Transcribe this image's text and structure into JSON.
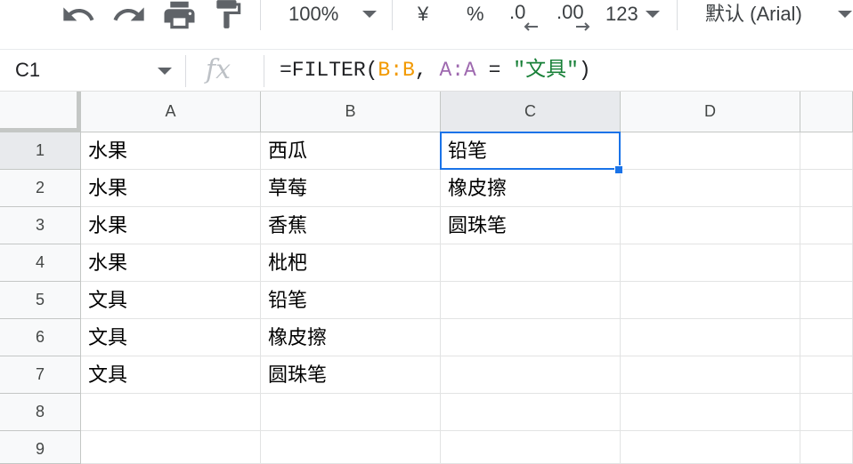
{
  "toolbar": {
    "icons": {
      "undo": "undo-icon",
      "redo": "redo-icon",
      "print": "print-icon",
      "paint_format": "paint-format-icon",
      "dropdown": "chevron-down-icon"
    },
    "zoom": "100%",
    "currency": "¥",
    "percent": "%",
    "decrease_decimal": ".0",
    "increase_decimal": ".00",
    "more_formats": "123",
    "font_selector": "默认 (Arial)"
  },
  "formula_bar": {
    "name_box": "C1",
    "fx": "fx",
    "tokens": [
      {
        "text": "=FILTER(",
        "color": "#202124"
      },
      {
        "text": "B:B",
        "color": "#f29900"
      },
      {
        "text": ", ",
        "color": "#202124"
      },
      {
        "text": "A:A",
        "color": "#9e69af"
      },
      {
        "text": " = ",
        "color": "#202124"
      },
      {
        "text": "\"文具\"",
        "color": "#188038"
      },
      {
        "text": ")",
        "color": "#202124"
      }
    ]
  },
  "sheet": {
    "columns": [
      "A",
      "B",
      "C",
      "D"
    ],
    "rows": [
      {
        "header": "1",
        "cells": [
          "水果",
          "西瓜",
          "铅笔",
          ""
        ]
      },
      {
        "header": "2",
        "cells": [
          "水果",
          "草莓",
          "橡皮擦",
          ""
        ]
      },
      {
        "header": "3",
        "cells": [
          "水果",
          "香蕉",
          "圆珠笔",
          ""
        ]
      },
      {
        "header": "4",
        "cells": [
          "水果",
          "枇杷",
          "",
          ""
        ]
      },
      {
        "header": "5",
        "cells": [
          "文具",
          "铅笔",
          "",
          ""
        ]
      },
      {
        "header": "6",
        "cells": [
          "文具",
          "橡皮擦",
          "",
          ""
        ]
      },
      {
        "header": "7",
        "cells": [
          "文具",
          "圆珠笔",
          "",
          ""
        ]
      },
      {
        "header": "8",
        "cells": [
          "",
          "",
          "",
          ""
        ]
      },
      {
        "header": "9",
        "cells": [
          "",
          "",
          "",
          ""
        ]
      }
    ]
  },
  "colors": {
    "selection": "#1a73e8",
    "header_background": "#f8f9fa",
    "header_selected_background": "#e8eaed",
    "gridline": "#e2e3e3",
    "icon": "#5f6368"
  }
}
